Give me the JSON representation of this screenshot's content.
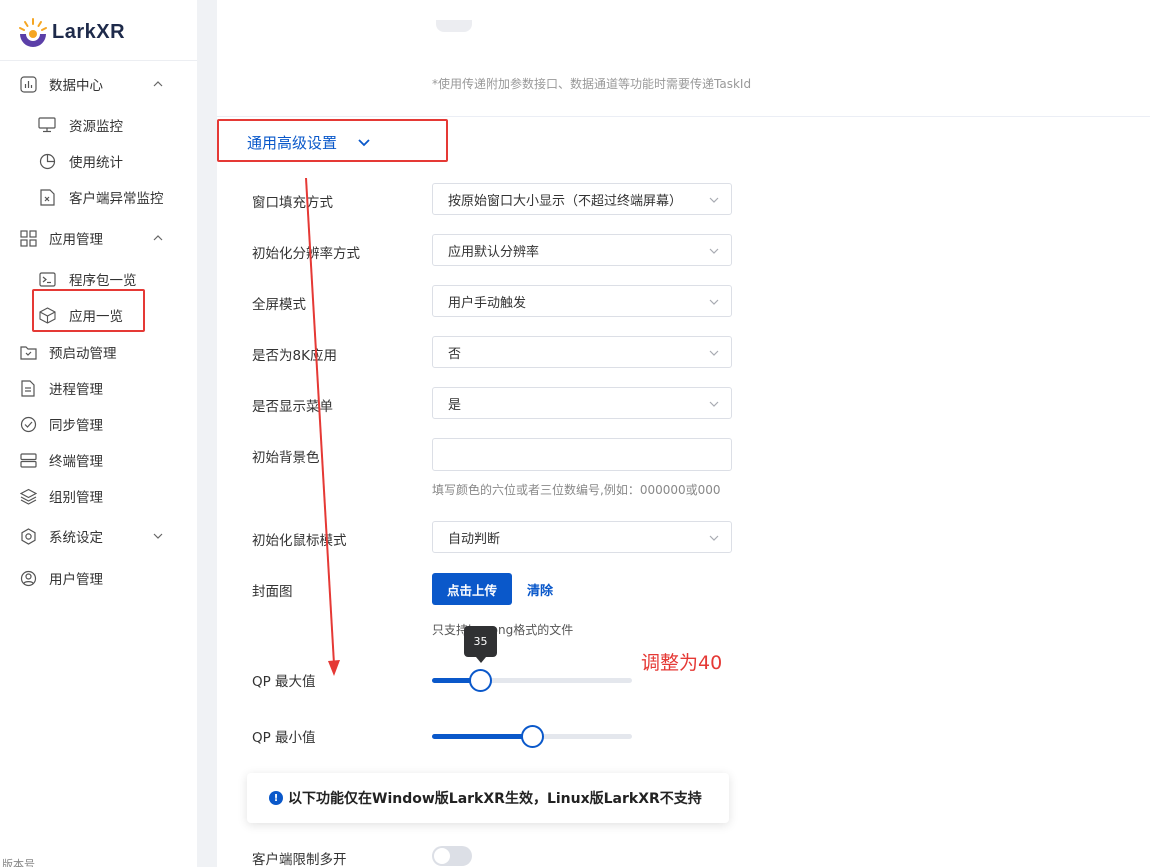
{
  "brand": {
    "name": "LarkXR"
  },
  "sidebar": {
    "items": [
      {
        "label": "数据中心",
        "icon": "chart-box-icon",
        "level": 1,
        "chevron": "up"
      },
      {
        "label": "资源监控",
        "icon": "monitor-icon",
        "level": 2
      },
      {
        "label": "使用统计",
        "icon": "pie-chart-icon",
        "level": 2
      },
      {
        "label": "客户端异常监控",
        "icon": "doc-error-icon",
        "level": 2
      },
      {
        "label": "应用管理",
        "icon": "grid-icon",
        "level": 1,
        "chevron": "up"
      },
      {
        "label": "程序包一览",
        "icon": "terminal-icon",
        "level": 2
      },
      {
        "label": "应用一览",
        "icon": "cube-icon",
        "level": 2
      },
      {
        "label": "预启动管理",
        "icon": "folder-icon",
        "level": 1
      },
      {
        "label": "进程管理",
        "icon": "document-icon",
        "level": 1
      },
      {
        "label": "同步管理",
        "icon": "check-circle-icon",
        "level": 1
      },
      {
        "label": "终端管理",
        "icon": "server-icon",
        "level": 1
      },
      {
        "label": "组别管理",
        "icon": "layers-icon",
        "level": 1
      },
      {
        "label": "系统设定",
        "icon": "gear-icon",
        "level": 1,
        "chevron": "down"
      },
      {
        "label": "用户管理",
        "icon": "user-icon",
        "level": 1
      }
    ],
    "footer": "版本号"
  },
  "main": {
    "top_note": "*使用传递附加参数接口、数据通道等功能时需要传递TaskId",
    "section_title": "通用高级设置",
    "fields": {
      "window_fill": {
        "label": "窗口填充方式",
        "value": "按原始窗口大小显示（不超过终端屏幕）"
      },
      "init_resolution": {
        "label": "初始化分辨率方式",
        "value": "应用默认分辨率"
      },
      "fullscreen": {
        "label": "全屏模式",
        "value": "用户手动触发"
      },
      "is_8k": {
        "label": "是否为8K应用",
        "value": "否"
      },
      "show_menu": {
        "label": "是否显示菜单",
        "value": "是"
      },
      "bg_color": {
        "label": "初始背景色",
        "value": "",
        "hint": "填写颜色的六位或者三位数编号,例如：000000或000"
      },
      "mouse_mode": {
        "label": "初始化鼠标模式",
        "value": "自动判断"
      },
      "cover": {
        "label": "封面图",
        "upload": "点击上传",
        "clear": "清除",
        "hint": "只支持jpg,png格式的文件"
      },
      "qp_max": {
        "label": "QP 最大值",
        "value": "35",
        "fraction": 0.24
      },
      "qp_min": {
        "label": "QP 最小值",
        "fraction": 0.5
      },
      "client_multi": {
        "label": "客户端限制多开",
        "enabled": false
      }
    },
    "notice": "以下功能仅在Window版LarkXR生效，Linux版LarkXR不支持"
  },
  "annotation": {
    "text": "调整为40",
    "color": "#e53935"
  },
  "colors": {
    "accent": "#0a58ca",
    "annotation": "#e53935"
  }
}
